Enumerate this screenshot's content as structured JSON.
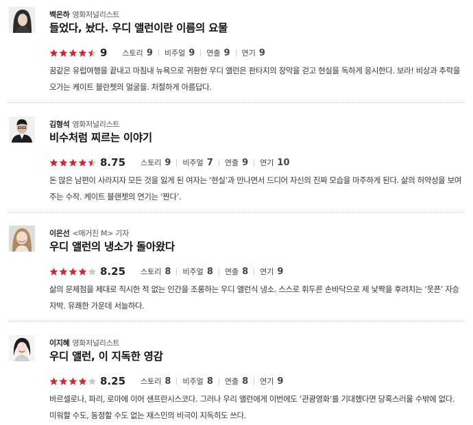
{
  "reviews": [
    {
      "name": "백은하",
      "role": "영화저널리스트",
      "title": "들었다, 놨다. 우디 앨런이란 이름의 요물",
      "stars": 4.5,
      "score": "9",
      "criteria": [
        {
          "label": "스토리",
          "value": "9"
        },
        {
          "label": "비주얼",
          "value": "9"
        },
        {
          "label": "연출",
          "value": "9"
        },
        {
          "label": "연기",
          "value": "9"
        }
      ],
      "body": "꿈같은 유럽여행을 끝내고 마침내 뉴욕으로 귀환한 우디 앨런은 판타지의 장막을 걷고 현실을 독하게 응시한다. 보라! 비상과 추락을 오가는 케이트 블란쳇의 얼굴을. 처절하게 아름답다."
    },
    {
      "name": "김형석",
      "role": "영화저널리스트",
      "title": "비수처럼 찌르는 이야기",
      "stars": 4.5,
      "score": "8.75",
      "criteria": [
        {
          "label": "스토리",
          "value": "9"
        },
        {
          "label": "비주얼",
          "value": "7"
        },
        {
          "label": "연출",
          "value": "9"
        },
        {
          "label": "연기",
          "value": "10"
        }
      ],
      "body": "돈 많은 남편이 사라지자 모든 것을 잃게 된 여자는 ‘현실’과 만나면서 드디어 자신의 진짜 모습을 마주하게 된다. 삶의 허약성을 보여주는 수작. 케이트 블랜쳇의 연기는 ‘짠다’."
    },
    {
      "name": "이은선",
      "role": "<매거진 M> 기자",
      "title": "우디 앨런의 냉소가 돌아왔다",
      "stars": 4,
      "score": "8.25",
      "criteria": [
        {
          "label": "스토리",
          "value": "8"
        },
        {
          "label": "비주얼",
          "value": "8"
        },
        {
          "label": "연출",
          "value": "8"
        },
        {
          "label": "연기",
          "value": "9"
        }
      ],
      "body": "삶의 문제점을 제대로 직시한 적 없는 인간을 조롱하는 우디 앨런식 냉소. 스스로 휘두른 손바닥으로 제 낯짝을 후려치는 ‘웃픈’ 자승자박. 유쾌한 가운데 서늘하다."
    },
    {
      "name": "이지혜",
      "role": "영화저널리스트",
      "title": "우디 앨런, 이 지독한 영감",
      "stars": 4,
      "score": "8.25",
      "criteria": [
        {
          "label": "스토리",
          "value": "8"
        },
        {
          "label": "비주얼",
          "value": "8"
        },
        {
          "label": "연출",
          "value": "8"
        },
        {
          "label": "연기",
          "value": "9"
        }
      ],
      "body": "바르셀로나, 파리, 로마에 이어 샌프란시스코다. 그러나 우리 앨런에게 이번에도 ‘관광영화’를 기대했다면 당혹스러울 수밖에 없다. 미워할 수도, 동정할 수도 없는 재스민의 비극이 지독히도 쓰다."
    }
  ],
  "colors": {
    "star_filled": "#d9222a",
    "star_empty": "#c8c8c8"
  }
}
